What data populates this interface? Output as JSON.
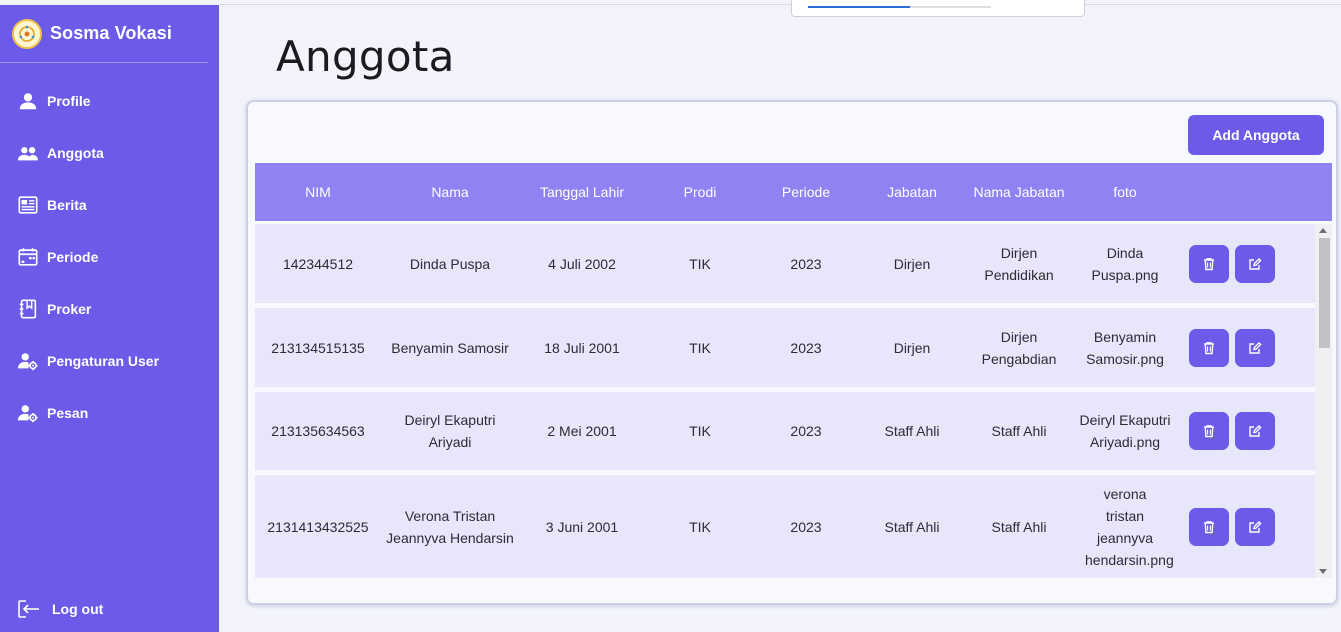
{
  "app": {
    "brand": "Sosma Vokasi"
  },
  "sidebar": {
    "items": [
      {
        "label": "Profile",
        "icon": "user-icon"
      },
      {
        "label": "Anggota",
        "icon": "users-icon"
      },
      {
        "label": "Berita",
        "icon": "newspaper-icon"
      },
      {
        "label": "Periode",
        "icon": "calendar-icon"
      },
      {
        "label": "Proker",
        "icon": "notebook-icon"
      },
      {
        "label": "Pengaturan User",
        "icon": "user-cog-icon"
      },
      {
        "label": "Pesan",
        "icon": "user-cog-icon"
      }
    ],
    "logout": "Log out"
  },
  "page": {
    "title": "Anggota",
    "add_button": "Add Anggota"
  },
  "table": {
    "headers": [
      "NIM",
      "Nama",
      "Tanggal Lahir",
      "Prodi",
      "Periode",
      "Jabatan",
      "Nama Jabatan",
      "foto",
      ""
    ],
    "rows": [
      {
        "nim": "142344512",
        "nama": "Dinda Puspa",
        "tgl": "4 Juli 2002",
        "prodi": "TIK",
        "periode": "2023",
        "jabatan": "Dirjen",
        "nama_jabatan": "Dirjen Pendidikan",
        "foto": "Dinda Puspa.png"
      },
      {
        "nim": "213134515135",
        "nama": "Benyamin Samosir",
        "tgl": "18 Juli 2001",
        "prodi": "TIK",
        "periode": "2023",
        "jabatan": "Dirjen",
        "nama_jabatan": "Dirjen Pengabdian",
        "foto": "Benyamin Samosir.png"
      },
      {
        "nim": "213135634563",
        "nama": "Deiryl Ekaputri Ariyadi",
        "tgl": "2 Mei 2001",
        "prodi": "TIK",
        "periode": "2023",
        "jabatan": "Staff Ahli",
        "nama_jabatan": "Staff Ahli",
        "foto": "Deiryl Ekaputri Ariyadi.png"
      },
      {
        "nim": "2131413432525",
        "nama": "Verona Tristan Jeannyva Hendarsin",
        "tgl": "3 Juni 2001",
        "prodi": "TIK",
        "periode": "2023",
        "jabatan": "Staff Ahli",
        "nama_jabatan": "Staff Ahli",
        "foto": "verona tristan jeannyva hendarsin.png"
      }
    ]
  },
  "colors": {
    "primary": "#6c5ae8",
    "header": "#8f82f3",
    "row": "#e8e6fb"
  },
  "popup": {
    "progress": 0.56
  }
}
